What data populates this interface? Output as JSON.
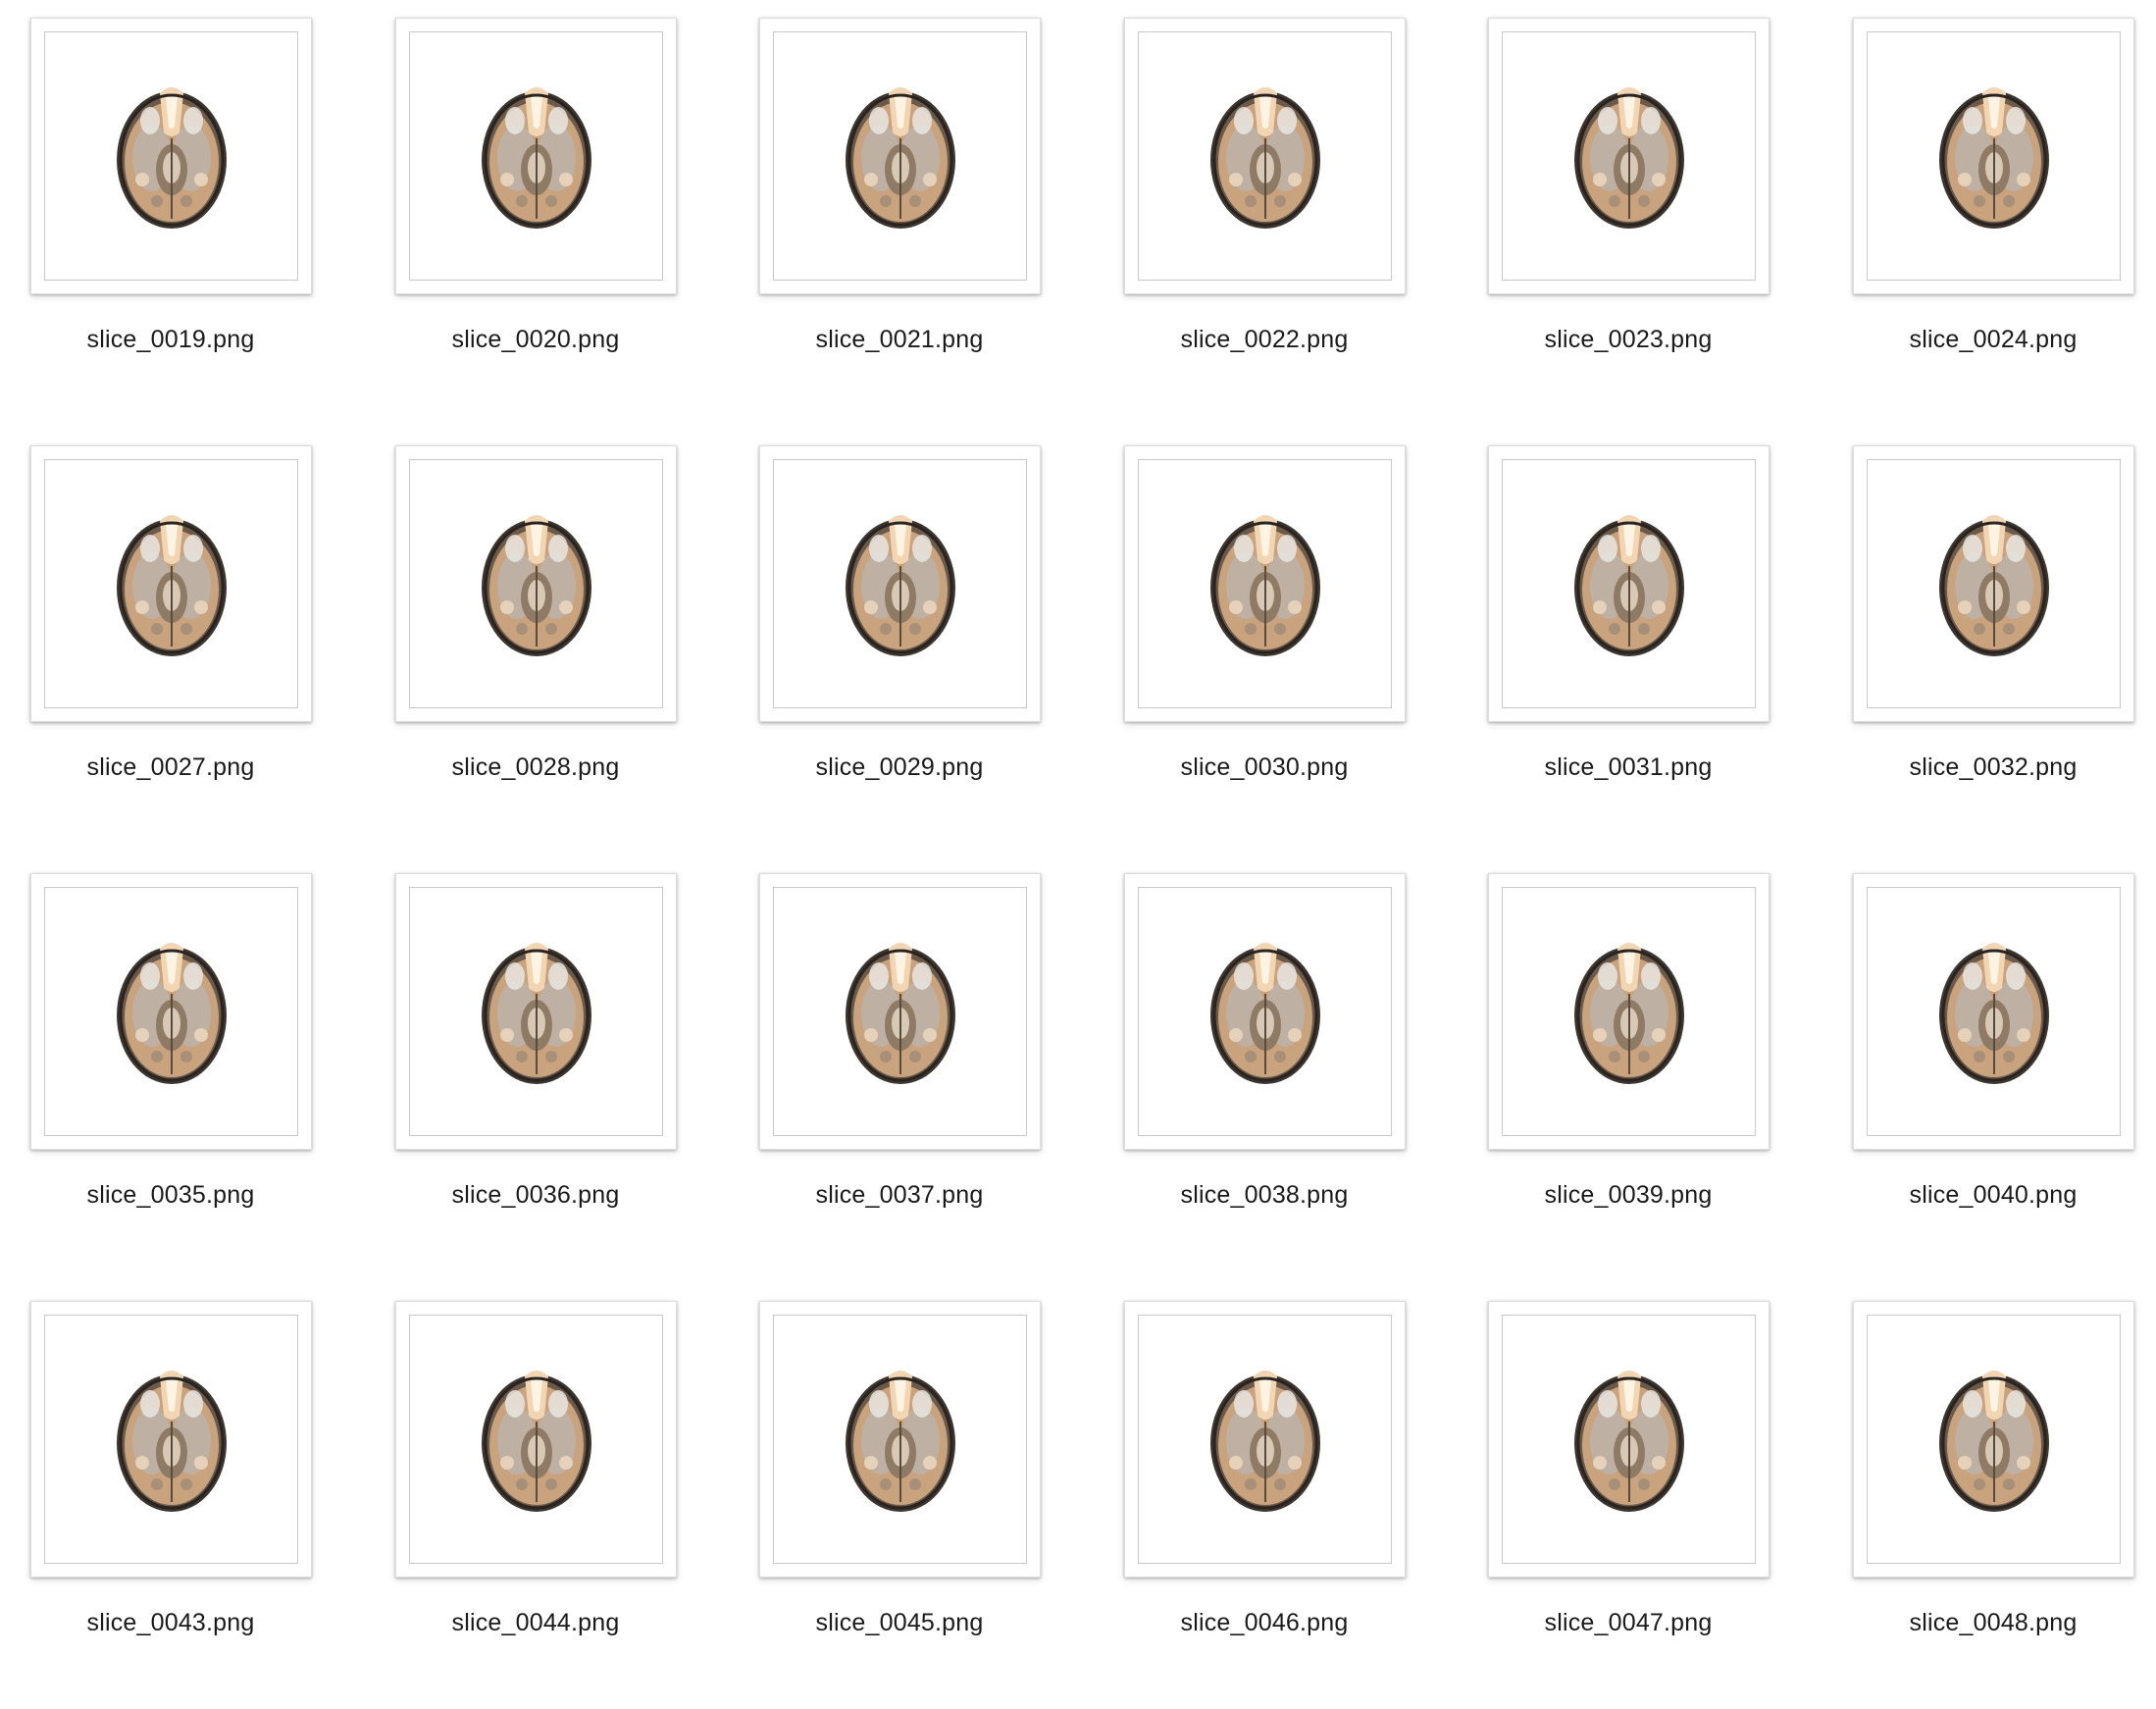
{
  "files": [
    {
      "name": "slice_0019.png",
      "thumbnail": "brain-slice-thumbnail"
    },
    {
      "name": "slice_0020.png",
      "thumbnail": "brain-slice-thumbnail"
    },
    {
      "name": "slice_0021.png",
      "thumbnail": "brain-slice-thumbnail"
    },
    {
      "name": "slice_0022.png",
      "thumbnail": "brain-slice-thumbnail"
    },
    {
      "name": "slice_0023.png",
      "thumbnail": "brain-slice-thumbnail"
    },
    {
      "name": "slice_0024.png",
      "thumbnail": "brain-slice-thumbnail"
    },
    {
      "name": "slice_0027.png",
      "thumbnail": "brain-slice-thumbnail"
    },
    {
      "name": "slice_0028.png",
      "thumbnail": "brain-slice-thumbnail"
    },
    {
      "name": "slice_0029.png",
      "thumbnail": "brain-slice-thumbnail"
    },
    {
      "name": "slice_0030.png",
      "thumbnail": "brain-slice-thumbnail"
    },
    {
      "name": "slice_0031.png",
      "thumbnail": "brain-slice-thumbnail"
    },
    {
      "name": "slice_0032.png",
      "thumbnail": "brain-slice-thumbnail"
    },
    {
      "name": "slice_0035.png",
      "thumbnail": "brain-slice-thumbnail"
    },
    {
      "name": "slice_0036.png",
      "thumbnail": "brain-slice-thumbnail"
    },
    {
      "name": "slice_0037.png",
      "thumbnail": "brain-slice-thumbnail"
    },
    {
      "name": "slice_0038.png",
      "thumbnail": "brain-slice-thumbnail"
    },
    {
      "name": "slice_0039.png",
      "thumbnail": "brain-slice-thumbnail"
    },
    {
      "name": "slice_0040.png",
      "thumbnail": "brain-slice-thumbnail"
    },
    {
      "name": "slice_0043.png",
      "thumbnail": "brain-slice-thumbnail"
    },
    {
      "name": "slice_0044.png",
      "thumbnail": "brain-slice-thumbnail"
    },
    {
      "name": "slice_0045.png",
      "thumbnail": "brain-slice-thumbnail"
    },
    {
      "name": "slice_0046.png",
      "thumbnail": "brain-slice-thumbnail"
    },
    {
      "name": "slice_0047.png",
      "thumbnail": "brain-slice-thumbnail"
    },
    {
      "name": "slice_0048.png",
      "thumbnail": "brain-slice-thumbnail"
    }
  ],
  "colors": {
    "background": "#ffffff",
    "label_text": "#1a1a1a",
    "brain_outer": "#3c3530",
    "brain_tissue": "#c9a27e",
    "brain_highlight": "#f2d6b3",
    "brain_silver": "#b9b5b0"
  }
}
